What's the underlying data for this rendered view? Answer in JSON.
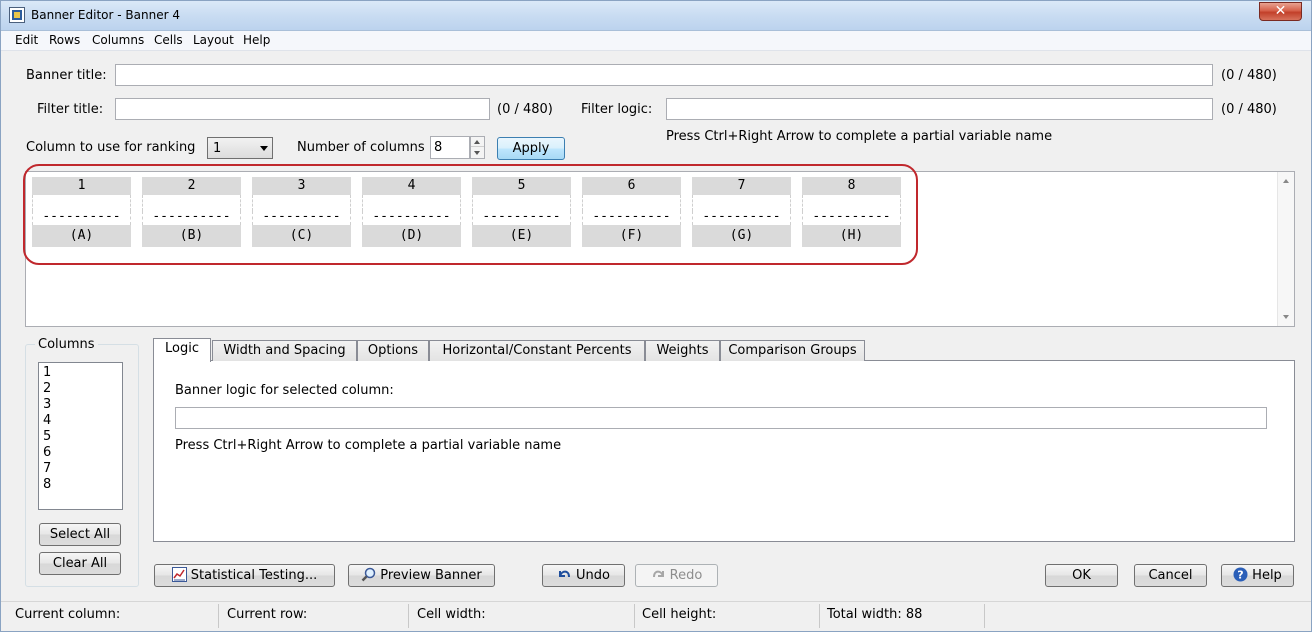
{
  "window": {
    "title": "Banner Editor - Banner 4",
    "close": "✕"
  },
  "menu": [
    "Edit",
    "Rows",
    "Columns",
    "Cells",
    "Layout",
    "Help"
  ],
  "banner_title": {
    "label": "Banner title:",
    "value": "",
    "count": "(0 / 480)"
  },
  "filter_title": {
    "label": "Filter title:",
    "value": "",
    "count": "(0 / 480)"
  },
  "filter_logic": {
    "label": "Filter logic:",
    "value": "",
    "count": "(0 / 480)",
    "hint": "Press Ctrl+Right Arrow to complete a partial variable name"
  },
  "ranking": {
    "label": "Column to use for ranking",
    "value": "1"
  },
  "num_columns": {
    "label": "Number of columns",
    "value": "8",
    "apply": "Apply"
  },
  "banner_columns": [
    {
      "number": "1",
      "dashes": "----------",
      "letter": "(A)"
    },
    {
      "number": "2",
      "dashes": "----------",
      "letter": "(B)"
    },
    {
      "number": "3",
      "dashes": "----------",
      "letter": "(C)"
    },
    {
      "number": "4",
      "dashes": "----------",
      "letter": "(D)"
    },
    {
      "number": "5",
      "dashes": "----------",
      "letter": "(E)"
    },
    {
      "number": "6",
      "dashes": "----------",
      "letter": "(F)"
    },
    {
      "number": "7",
      "dashes": "----------",
      "letter": "(G)"
    },
    {
      "number": "8",
      "dashes": "----------",
      "letter": "(H)"
    }
  ],
  "columns_group": {
    "title": "Columns",
    "items": [
      "1",
      "2",
      "3",
      "4",
      "5",
      "6",
      "7",
      "8"
    ],
    "select_all": "Select All",
    "clear_all": "Clear All"
  },
  "tabs": [
    "Logic",
    "Width and Spacing",
    "Options",
    "Horizontal/Constant Percents",
    "Weights",
    "Comparison Groups"
  ],
  "logic_panel": {
    "label": "Banner logic for selected column:",
    "value": "",
    "hint": "Press Ctrl+Right Arrow to complete a partial variable name"
  },
  "buttons": {
    "statistical_testing": "Statistical Testing...",
    "preview_banner": "Preview Banner",
    "undo": "Undo",
    "redo": "Redo",
    "ok": "OK",
    "cancel": "Cancel",
    "help": "Help"
  },
  "status": {
    "current_column": "Current column:",
    "current_row": "Current row:",
    "cell_width": "Cell width:",
    "cell_height": "Cell height:",
    "total_width": "Total width: 88"
  },
  "colors": {
    "highlight": "#c0282d",
    "header_cell": "#dadada",
    "focus_button": "#a7d9f5"
  }
}
